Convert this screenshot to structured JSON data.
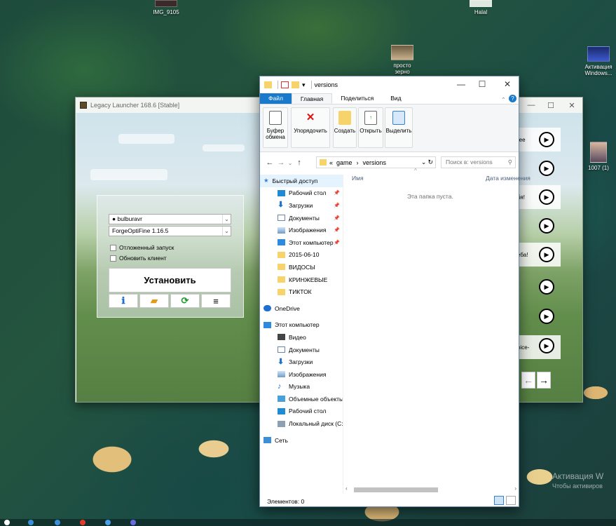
{
  "desktop": {
    "icons": [
      {
        "label": "IMG_9105"
      },
      {
        "label": "Halal"
      },
      {
        "label": "просто",
        "label2": "зерно"
      },
      {
        "label": "Активация",
        "label2": "Windows..."
      },
      {
        "label": "1007 (1)"
      }
    ],
    "watermark": {
      "title": "Активация W",
      "subtitle": "Чтобы активиров"
    }
  },
  "launcher": {
    "title": "Legacy Launcher 168.6 [Stable]",
    "account": "bulburavr",
    "version": "ForgeOptiFine 1.16.5",
    "checkbox_delayed": "Отложенный запуск",
    "checkbox_update": "Обновить клиент",
    "install_label": "Установить",
    "news_snippets": [
      "ree",
      "бя!",
      "еба!",
      "pice-"
    ],
    "nav_prev": "←",
    "nav_next": "→"
  },
  "explorer": {
    "title": "versions",
    "tabs": [
      {
        "label": "Файл"
      },
      {
        "label": "Главная"
      },
      {
        "label": "Поделиться"
      },
      {
        "label": "Вид"
      }
    ],
    "ribbon": {
      "clipboard": "Буфер обмена",
      "organize": "Упорядочить",
      "new": "Создать",
      "open": "Открыть",
      "select": "Выделить"
    },
    "breadcrumb": {
      "root": "«",
      "part1": "game",
      "part2": "versions"
    },
    "search_placeholder": "Поиск в: versions",
    "nav": {
      "quick_access": "Быстрый доступ",
      "quick_items": [
        {
          "label": "Рабочий стол"
        },
        {
          "label": "Загрузки"
        },
        {
          "label": "Документы"
        },
        {
          "label": "Изображения"
        },
        {
          "label": "Этот компьютер"
        },
        {
          "label": "2015-06-10"
        },
        {
          "label": "ВИДОСЫ"
        },
        {
          "label": "КРИНЖЕВЫЕ"
        },
        {
          "label": "ТИКТОК"
        }
      ],
      "onedrive": "OneDrive",
      "this_pc": "Этот компьютер",
      "pc_items": [
        {
          "label": "Видео"
        },
        {
          "label": "Документы"
        },
        {
          "label": "Загрузки"
        },
        {
          "label": "Изображения"
        },
        {
          "label": "Музыка"
        },
        {
          "label": "Объемные объекты"
        },
        {
          "label": "Рабочий стол"
        },
        {
          "label": "Локальный диск (C:)"
        }
      ],
      "network": "Сеть"
    },
    "columns": {
      "name": "Имя",
      "date": "Дата изменения"
    },
    "empty_text": "Эта папка пуста.",
    "status": "Элементов: 0"
  }
}
